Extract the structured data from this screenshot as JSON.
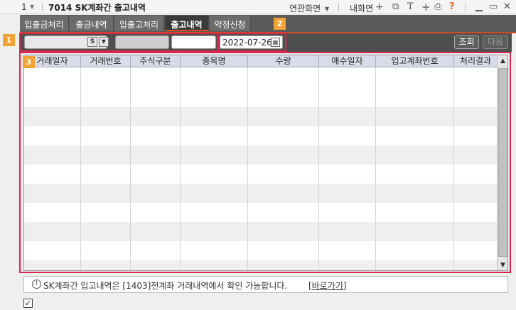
{
  "titlebar": {
    "screen_number": "1",
    "title": "7014 SK계좌간 출고내역",
    "linked_screen": "연관화면",
    "my_screen": "내화면",
    "icons": [
      "chevron-down-icon",
      "screen-copy-icon",
      "font-icon",
      "plus-icon",
      "print-icon",
      "help-icon",
      "minimize-icon",
      "maximize-icon",
      "close-icon"
    ],
    "font_glyph": "T",
    "help_glyph": "?"
  },
  "tabs": [
    {
      "label": "입출금처리",
      "active": false
    },
    {
      "label": "출금내역",
      "active": false
    },
    {
      "label": "입출고처리",
      "active": false
    },
    {
      "label": "출고내역",
      "active": true
    },
    {
      "label": "약정신청",
      "active": false
    }
  ],
  "markers": {
    "m1": "1",
    "m2": "2",
    "m3": "3"
  },
  "toolbar": {
    "account_field": "",
    "s_button": "S",
    "date": "2022-07-26",
    "query_button": "조회",
    "next_button": "다음"
  },
  "grid": {
    "columns": [
      "거래일자",
      "거래번호",
      "주식구분",
      "종목명",
      "수량",
      "매수일자",
      "입고계좌번호",
      "처리결과"
    ],
    "rows": []
  },
  "info": {
    "message": "SK계좌간 입고내역은 [1403]전계좌 거래내역에서 확인 가능합니다.",
    "link": "[바로가기]"
  },
  "colors": {
    "accent": "#d24a20",
    "marker": "#f3a233",
    "highlight_box": "#d6284c"
  }
}
